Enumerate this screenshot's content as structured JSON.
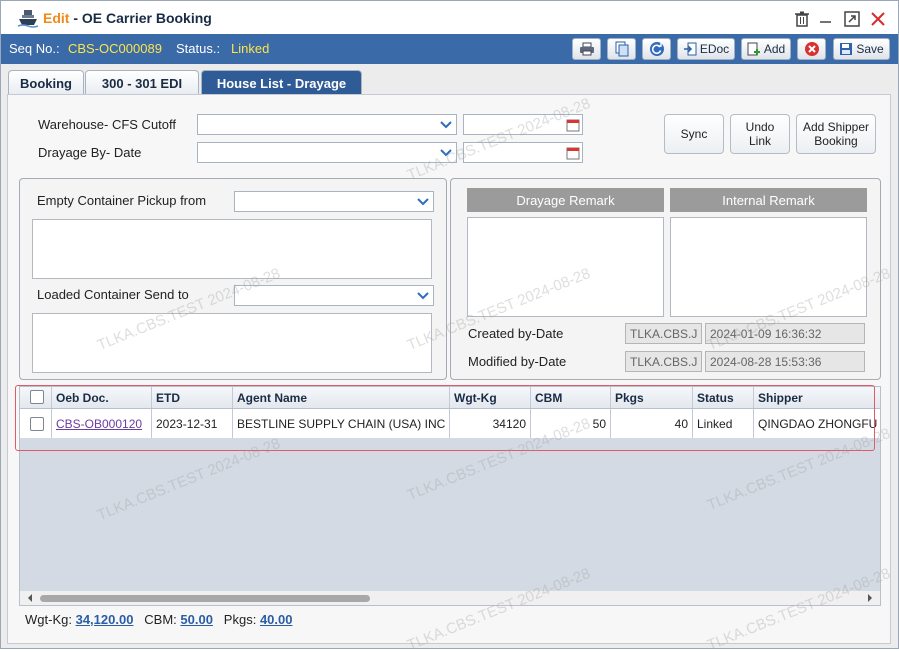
{
  "title": {
    "mode": "Edit",
    "separator": " - ",
    "name": "OE Carrier Booking"
  },
  "info": {
    "seq_label": "Seq No.:",
    "seq_value": "CBS-OC000089",
    "status_label": "Status.:",
    "status_value": "Linked"
  },
  "actions": {
    "edoc": "EDoc",
    "add": "Add",
    "save": "Save"
  },
  "tabs": [
    {
      "label": "Booking",
      "active": false
    },
    {
      "label": "300 - 301 EDI",
      "active": false
    },
    {
      "label": "House List - Drayage",
      "active": true
    }
  ],
  "form": {
    "warehouse_cutoff_label": "Warehouse- CFS Cutoff",
    "drayage_by_date_label": "Drayage By- Date",
    "sync_label": "Sync",
    "undo_link_label": "Undo\nLink",
    "add_shipper_booking_label": "Add Shipper\nBooking",
    "empty_pickup_label": "Empty Container Pickup from",
    "loaded_send_label": "Loaded Container Send to",
    "drayage_remark_label": "Drayage Remark",
    "internal_remark_label": "Internal Remark",
    "created_label": "Created by-Date",
    "created_by": "TLKA.CBS.J",
    "created_date": "2024-01-09 16:36:32",
    "modified_label": "Modified by-Date",
    "modified_by": "TLKA.CBS.J",
    "modified_date": "2024-08-28 15:53:36"
  },
  "grid": {
    "columns": [
      "Oeb Doc.",
      "ETD",
      "Agent Name",
      "Wgt-Kg",
      "CBM",
      "Pkgs",
      "Status",
      "Shipper"
    ],
    "rows": [
      {
        "doc": "CBS-OB000120",
        "etd": "2023-12-31",
        "agent": "BESTLINE SUPPLY CHAIN (USA) INC",
        "wgt": "34120",
        "cbm": "50",
        "pkgs": "40",
        "status": "Linked",
        "shipper": "QINGDAO ZHONGFU"
      }
    ]
  },
  "totals": {
    "wgt_label": "Wgt-Kg:",
    "wgt": "34,120.00",
    "cbm_label": "CBM:",
    "cbm": "50.00",
    "pkgs_label": "Pkgs:",
    "pkgs": "40.00"
  },
  "watermark": "TLKA.CBS.TEST 2024-08-28",
  "colors": {
    "title_bar": "#ffffff",
    "info_bar": "#3a6aa8",
    "status_yellow": "#ffe44a",
    "edit_orange": "#f28a1b",
    "active_tab": "#2f5c96",
    "highlight": "#e05a6a"
  }
}
